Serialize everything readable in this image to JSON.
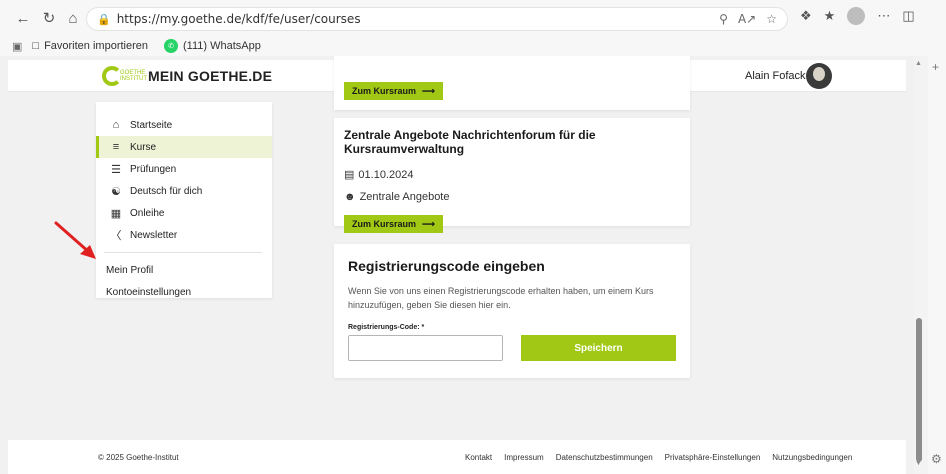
{
  "browser": {
    "url": "https://my.goethe.de/kdf/fe/user/courses"
  },
  "favorites": {
    "items": [
      {
        "label": "Favoriten importieren"
      },
      {
        "label": "(111) WhatsApp"
      }
    ]
  },
  "header": {
    "brand": "MEIN GOETHE.DE",
    "logo_small": "GOETHE INSTITUT",
    "user_name": "Alain Fofack"
  },
  "sidebar": {
    "items": [
      {
        "label": "Startseite",
        "icon": "home-icon"
      },
      {
        "label": "Kurse",
        "icon": "courses-icon",
        "active": true
      },
      {
        "label": "Prüfungen",
        "icon": "exams-icon"
      },
      {
        "label": "Deutsch für dich",
        "icon": "community-icon"
      },
      {
        "label": "Onleihe",
        "icon": "library-icon"
      },
      {
        "label": "Newsletter",
        "icon": "megaphone-icon"
      }
    ],
    "links": [
      {
        "label": "Mein Profil"
      },
      {
        "label": "Kontoeinstellungen"
      }
    ]
  },
  "courses": {
    "button_label": "Zum Kursraum",
    "card": {
      "title": "Zentrale Angebote Nachrichtenforum für die Kursraumverwaltung",
      "date": "01.10.2024",
      "provider": "Zentrale Angebote"
    }
  },
  "registration": {
    "title": "Registrierungscode eingeben",
    "description": "Wenn Sie von uns einen Registrierungscode erhalten haben, um einem Kurs hinzuzufügen, geben Sie diesen hier ein.",
    "field_label": "Registrierungs-Code: *",
    "field_value": "",
    "save_label": "Speichern"
  },
  "footer": {
    "copyright": "© 2025 Goethe-Institut",
    "links": [
      "Kontakt",
      "Impressum",
      "Datenschutzbestimmungen",
      "Privatsphäre-Einstellungen",
      "Nutzungsbedingungen"
    ]
  },
  "colors": {
    "accent": "#a0c814",
    "annotation": "#e02020"
  }
}
